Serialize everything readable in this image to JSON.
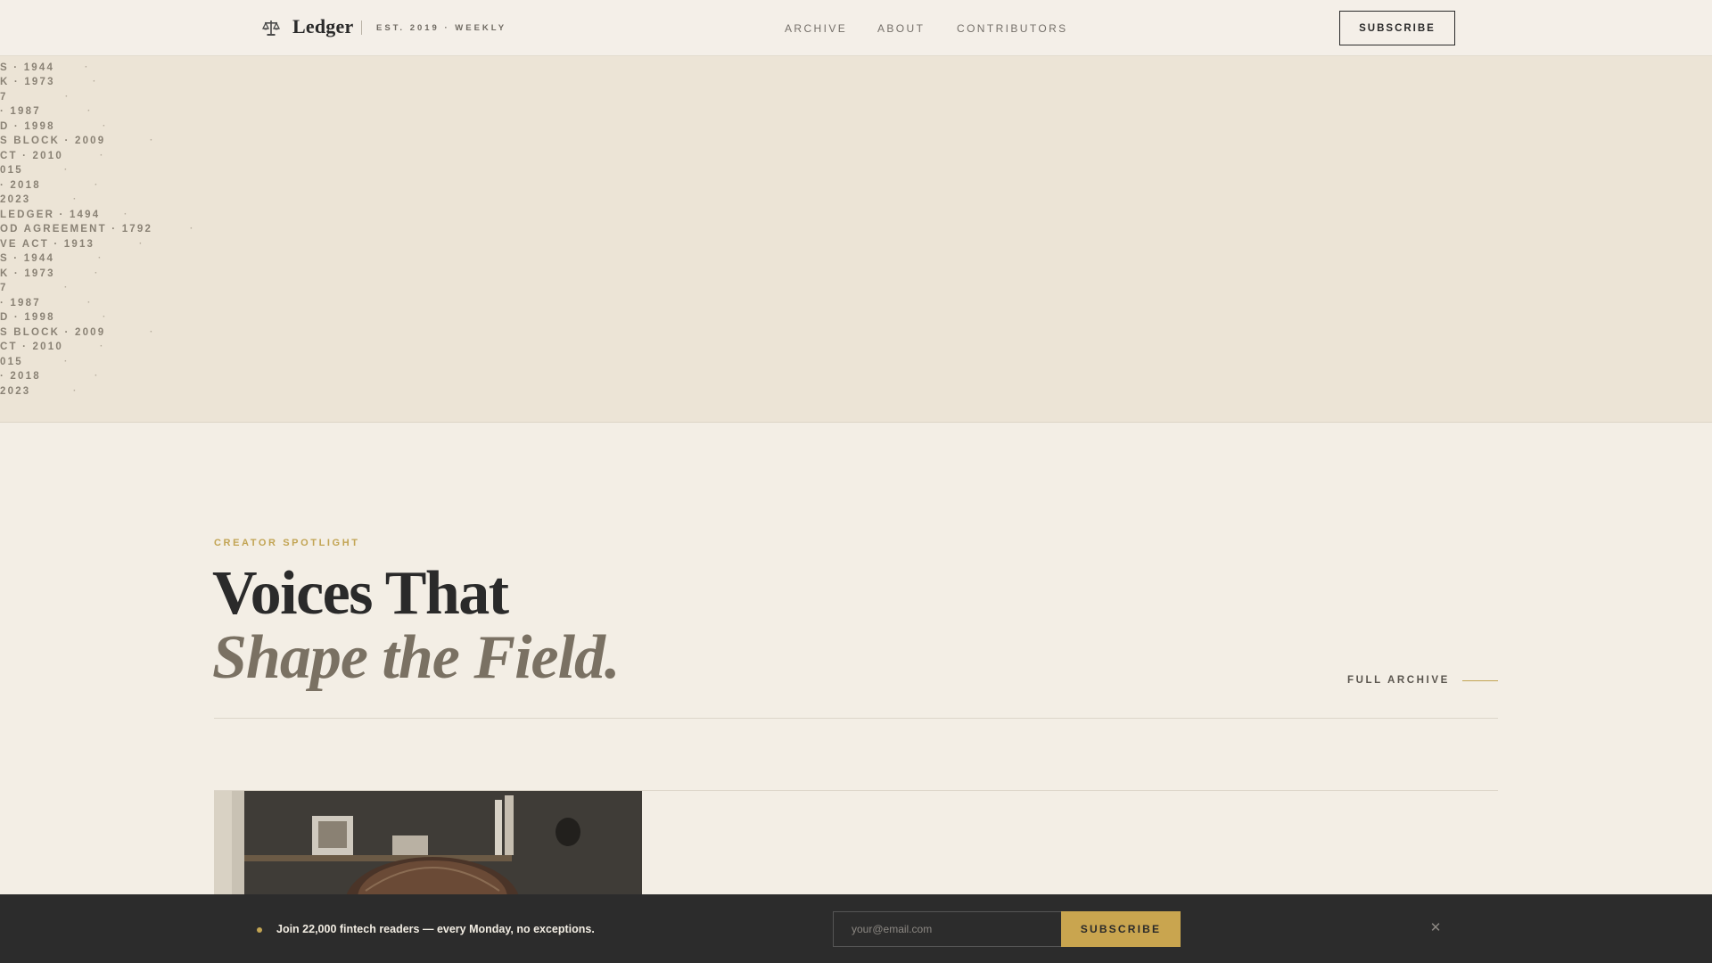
{
  "header": {
    "brand": "Ledger",
    "tagline": "EST. 2019 · WEEKLY",
    "logo_icon": "scales-icon",
    "nav": [
      {
        "label": "ARCHIVE"
      },
      {
        "label": "ABOUT"
      },
      {
        "label": "CONTRIBUTORS"
      }
    ],
    "subscribe_label": "SUBSCRIBE"
  },
  "hero": {
    "ticker": [
      "VE ACT · 1913",
      "S · 1944",
      "K · 1973",
      "7",
      "· 1987",
      "D · 1998",
      "S BLOCK · 2009",
      "CT · 2010",
      "015",
      "· 2018",
      "2023",
      "LEDGER · 1494",
      "OD AGREEMENT · 1792",
      "VE ACT · 1913",
      "S · 1944",
      "K · 1973",
      "7",
      "· 1987",
      "D · 1998",
      "S BLOCK · 2009",
      "CT · 2010",
      "015",
      "· 2018",
      "2023"
    ]
  },
  "section": {
    "eyebrow": "CREATOR SPOTLIGHT",
    "headline_line1": "Voices That",
    "headline_line2": "Shape the Field.",
    "archive_link": "FULL ARCHIVE"
  },
  "subscribe_bar": {
    "message": "Join 22,000 fintech readers — every Monday, no exceptions.",
    "email_placeholder": "your@email.com",
    "button_label": "SUBSCRIBE",
    "close_icon": "close-icon"
  },
  "colors": {
    "accent_gold": "#c2a453",
    "background": "#f3eee5",
    "hero_band": "#ece4d6",
    "dark_bar": "#2c2c2c"
  }
}
